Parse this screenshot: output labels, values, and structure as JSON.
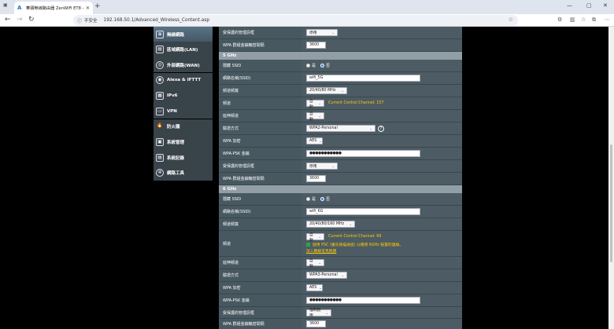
{
  "browser": {
    "tab_title": "華碩無線路由器 ZenWiFi ET8 -",
    "insecure_label": "不安全",
    "url": "192.168.50.1/Advanced_Wireless_Content.asp",
    "new_tab_symbol": "+",
    "icons": [
      "menu-icon",
      "back-icon",
      "forward-icon",
      "reload-icon",
      "info-icon",
      "star-icon",
      "extensions-icon",
      "split-icon",
      "favorites-icon",
      "collections-icon",
      "profile-icon",
      "more-icon"
    ]
  },
  "sidebar": {
    "items": [
      {
        "label": "無線網路",
        "icon": "wireless-icon",
        "active": true
      },
      {
        "label": "區域網路(LAN)",
        "icon": "lan-icon"
      },
      {
        "label": "外部網路(WAN)",
        "icon": "wan-icon"
      },
      {
        "label": "Alexa & IFTTT",
        "icon": "alexa-icon"
      },
      {
        "label": "IPv6",
        "icon": "ipv6-icon"
      },
      {
        "label": "VPN",
        "icon": "vpn-icon"
      },
      {
        "label": "防火牆",
        "icon": "firewall-icon"
      },
      {
        "label": "系統管理",
        "icon": "admin-icon"
      },
      {
        "label": "系統記錄",
        "icon": "log-icon"
      },
      {
        "label": "網路工具",
        "icon": "tools-icon"
      }
    ]
  },
  "top": {
    "protected_mgmt_label": "受保護的管理訊框",
    "protected_mgmt_value": "停用",
    "gtk_label": "WPA 群組金鑰輪替間隔",
    "gtk_value": "3600"
  },
  "band5": {
    "header": "5 GHz",
    "hide_ssid_label": "隱藏 SSID",
    "yes": "是",
    "no": "否",
    "ssid_label": "網路名稱(SSID)",
    "ssid_value": "wifi_5G",
    "bandwidth_label": "頻道頻寬",
    "bandwidth_value": "20/40/80 MHz",
    "channel_label": "頻道",
    "channel_value": "自動",
    "channel_note": "Current Control Channel: 157",
    "ext_channel_label": "延伸頻道",
    "ext_channel_value": "自動",
    "auth_label": "驗證方式",
    "auth_value": "WPA2-Personal",
    "help": "?",
    "enc_label": "WPA 加密",
    "enc_value": "AES",
    "psk_label": "WPA-PSK 金鑰",
    "psk_value": "●●●●●●●●●●●",
    "pmf_label": "受保護的管理訊框",
    "pmf_value": "停用",
    "gtk_label": "WPA 群組金鑰輪替間隔",
    "gtk_value": "3600"
  },
  "band6": {
    "header": "6 GHz",
    "hide_ssid_label": "隱藏 SSID",
    "yes": "是",
    "no": "否",
    "ssid_label": "網路名稱(SSID)",
    "ssid_value": "wifi_6G",
    "bandwidth_label": "頻道頻寬",
    "bandwidth_value": "20/40/80/160 MHz",
    "channel_label": "頻道",
    "channel_value": "自動",
    "channel_note": "Current Control Channel: 69",
    "psc_text": "啟用 PSC (優先掃描通道) 以確保 6GHz 裝置的連線。",
    "psc_link": "深入瞭解常見問題",
    "ext_channel_label": "延伸頻道",
    "ext_channel_value": "自動",
    "auth_label": "驗證方式",
    "auth_value": "WPA3-Personal",
    "enc_label": "WPA 加密",
    "enc_value": "AES",
    "psk_label": "WPA-PSK 金鑰",
    "psk_value": "●●●●●●●●●●●",
    "pmf_label": "受保護的管理訊框",
    "pmf_value": "強制啟用",
    "gtk_label": "WPA 群組金鑰輪替間隔",
    "gtk_value": "3600"
  }
}
